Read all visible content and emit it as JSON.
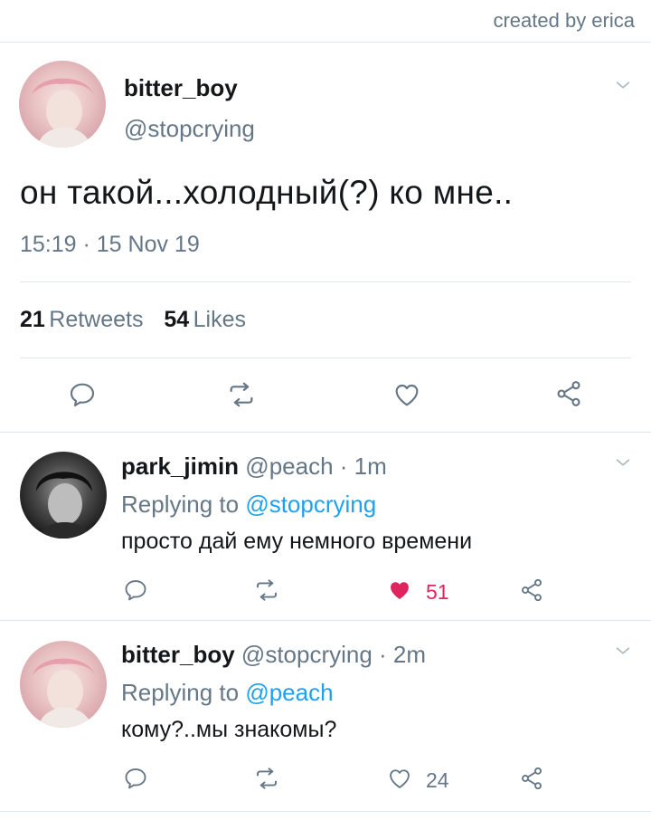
{
  "credit": "created by erica",
  "main_tweet": {
    "display_name": "bitter_boy",
    "handle": "@stopcrying",
    "text": "он такой...холодный(?) ко мне..",
    "timestamp": "15:19 · 15 Nov 19",
    "retweets_count": "21",
    "retweets_label": "Retweets",
    "likes_count": "54",
    "likes_label": "Likes"
  },
  "replies": [
    {
      "display_name": "park_jimin",
      "handle": "@peach · 1m",
      "replying_prefix": "Replying to",
      "replying_to": "@stopcrying",
      "text": "просто дай ему немного времени",
      "like_count": "51",
      "liked": true
    },
    {
      "display_name": "bitter_boy",
      "handle": "@stopcrying · 2m",
      "replying_prefix": "Replying to",
      "replying_to": "@peach",
      "text": "кому?..мы знакомы?",
      "like_count": "24",
      "liked": false
    }
  ],
  "icons": {
    "reply": "reply-icon",
    "retweet": "retweet-icon",
    "like": "heart-icon",
    "share": "share-icon",
    "menu": "chevron-down-icon"
  },
  "colors": {
    "link": "#1da1f2",
    "muted": "#657786",
    "like_active": "#e0245e",
    "divider": "#e1e8ed",
    "icon": "#657786"
  }
}
